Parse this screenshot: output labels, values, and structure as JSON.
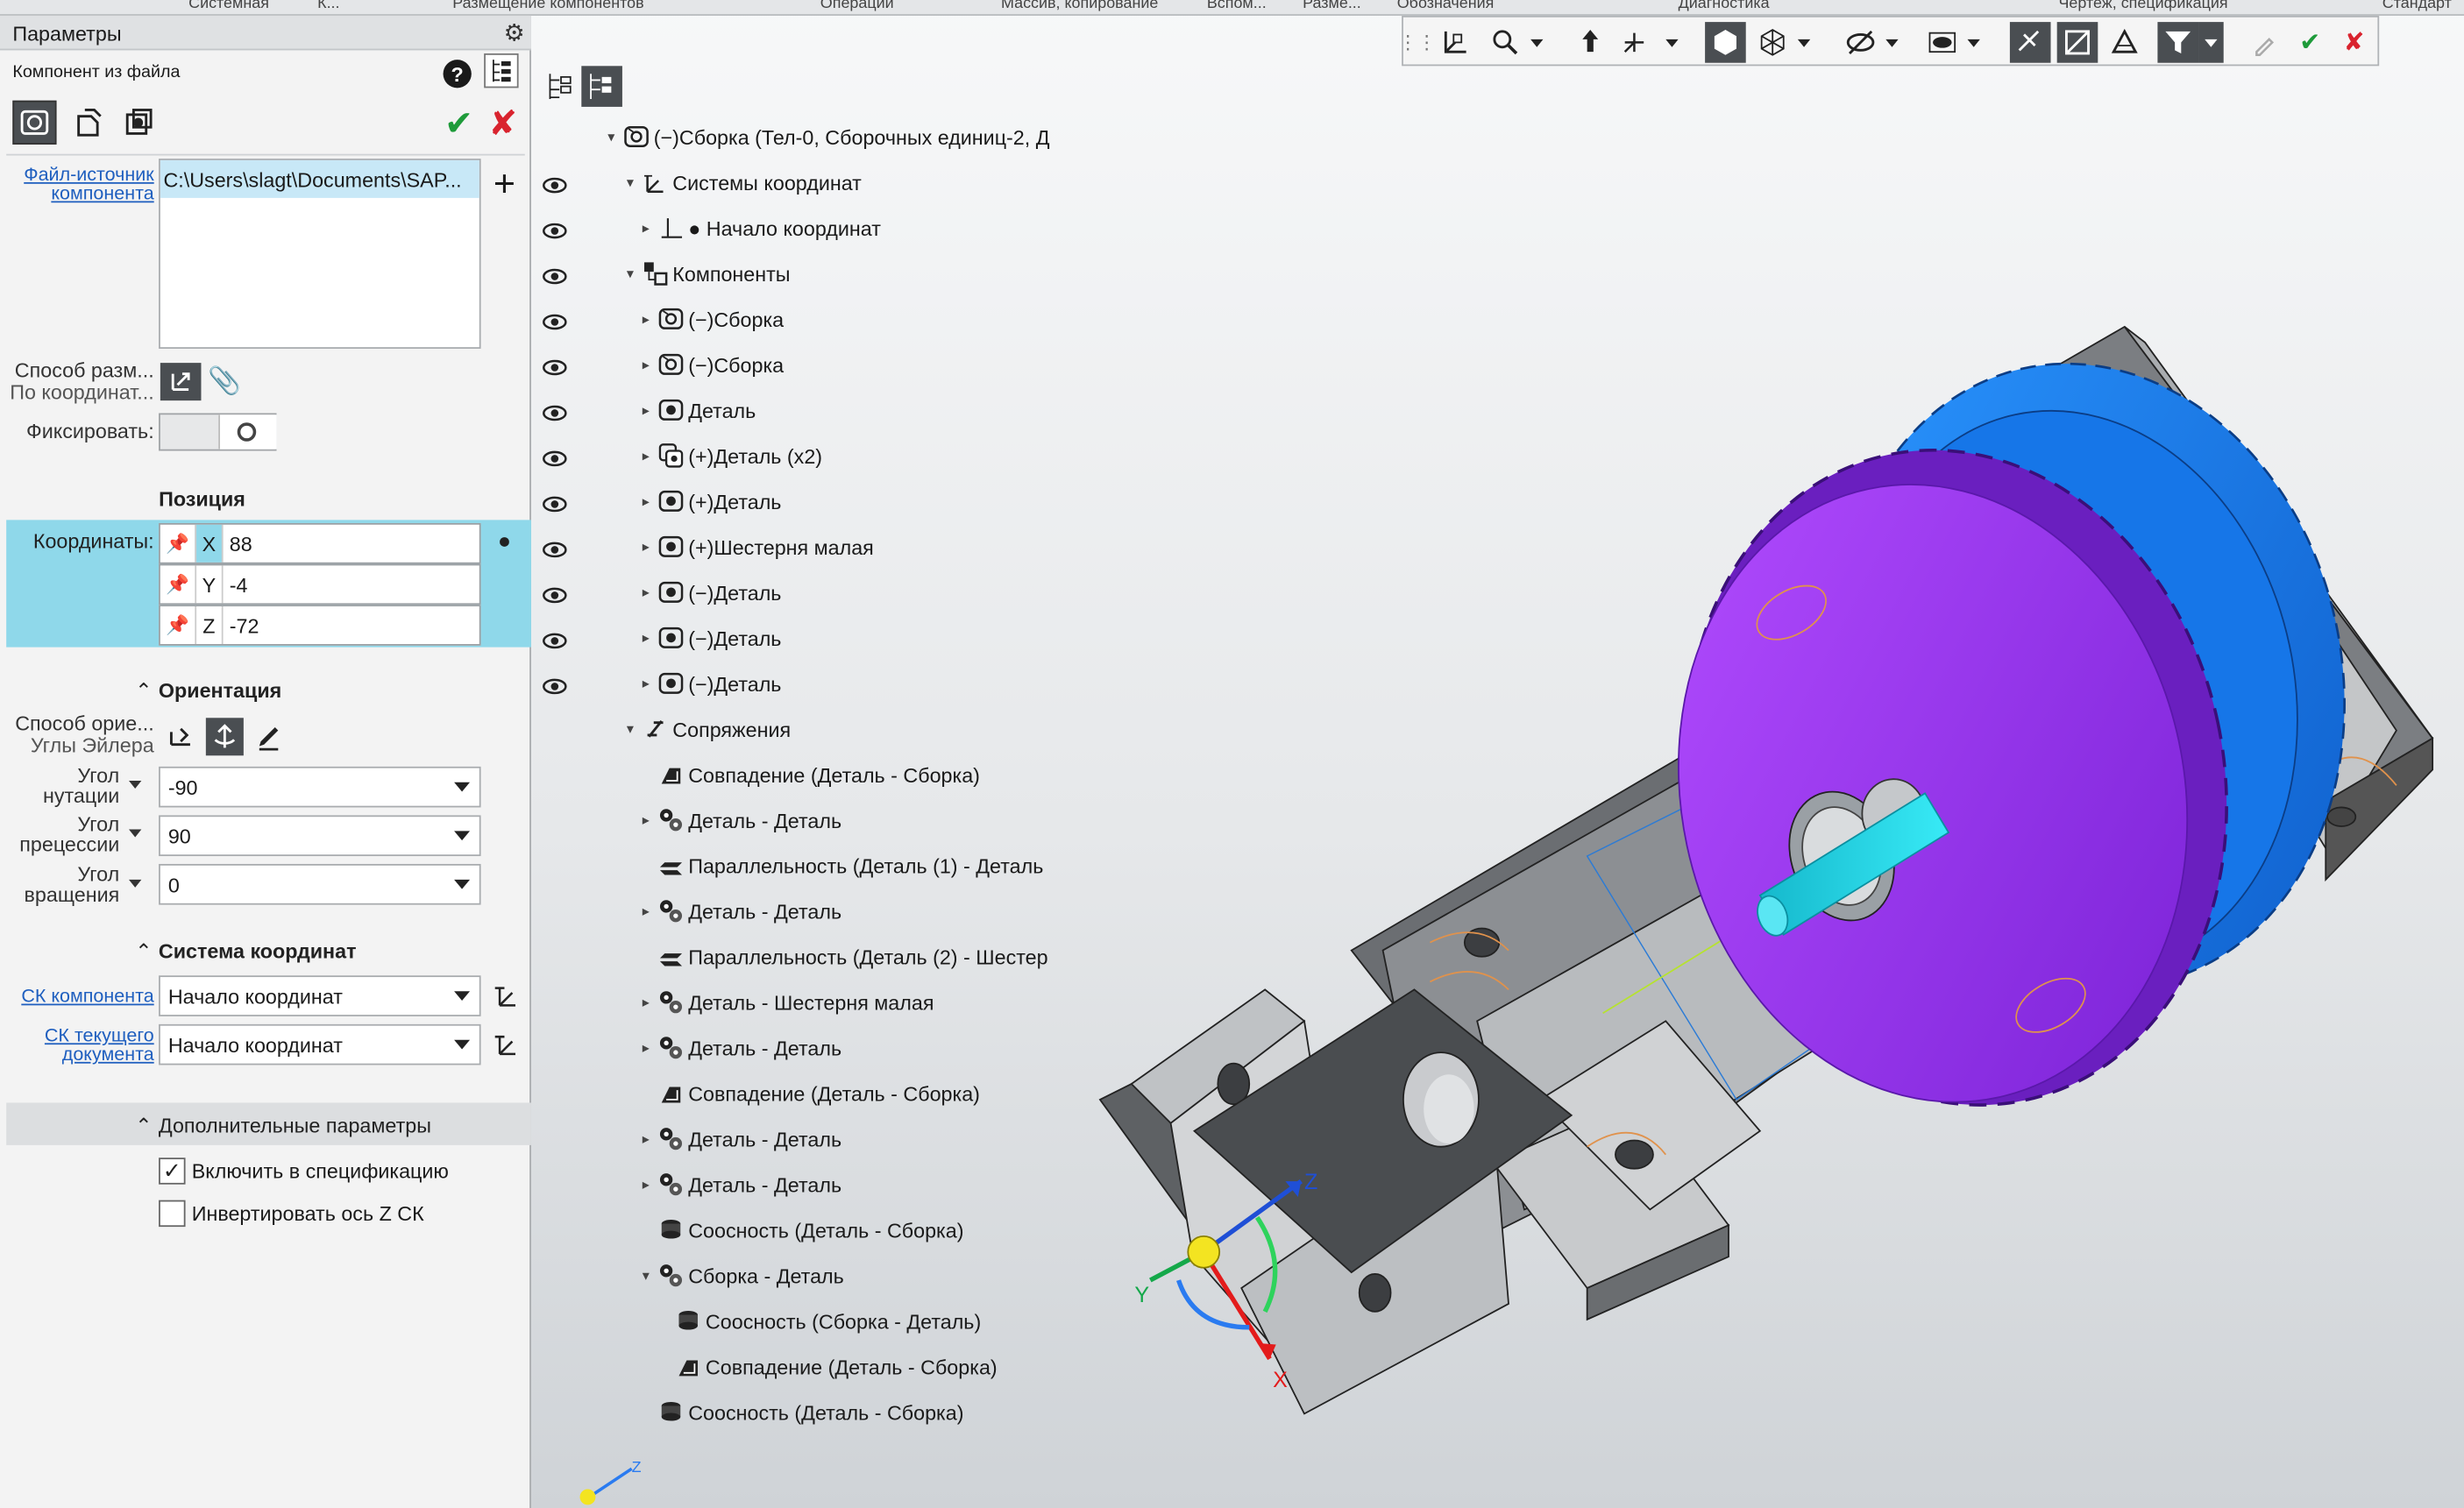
{
  "ribbon_tabs": [
    "Системная",
    "К...",
    "Размещение компонентов",
    "Операции",
    "Массив, копирование",
    "Вспом...",
    "Разме...",
    "Обозначения",
    "Диагностика",
    "Чертеж, спецификация",
    "Стандарт"
  ],
  "panel": {
    "title": "Параметры",
    "subtitle": "Компонент из файла",
    "source_label": "Файл-источник компонента",
    "source_value": "C:\\Users\\slagt\\Documents\\SAP...",
    "placement_label": "Способ разм...",
    "placement_value": "По координат...",
    "fix_label": "Фиксировать:",
    "position_header": "Позиция",
    "coords_label": "Координаты:",
    "coords": [
      {
        "axis": "X",
        "value": "88"
      },
      {
        "axis": "Y",
        "value": "-4"
      },
      {
        "axis": "Z",
        "value": "-72"
      }
    ],
    "orientation_header": "Ориентация",
    "orient_method_label": "Способ орие...",
    "orient_method_value": "Углы Эйлера",
    "angles": [
      {
        "label1": "Угол",
        "label2": "нутации",
        "value": "-90"
      },
      {
        "label1": "Угол",
        "label2": "прецессии",
        "value": "90"
      },
      {
        "label1": "Угол",
        "label2": "вращения",
        "value": "0"
      }
    ],
    "cs_header": "Система координат",
    "cs_component_label": "СК компонента",
    "cs_component_value": "Начало координат",
    "cs_document_label1": "СК текущего",
    "cs_document_label2": "документа",
    "cs_document_value": "Начало координат",
    "extra_header": "Дополнительные параметры",
    "include_spec_label": "Включить в спецификацию",
    "include_spec_checked": true,
    "invert_z_label": "Инвертировать ось Z СК",
    "invert_z_checked": false
  },
  "tree": [
    {
      "text": "(−)Сборка (Тел-0, Сборочных единиц-2, Д",
      "level": 0,
      "icon": "assembly",
      "expand": "open",
      "eye": false
    },
    {
      "text": "Системы координат",
      "level": 1,
      "icon": "cs",
      "expand": "open",
      "eye": true
    },
    {
      "text": "● Начало координат",
      "level": 2,
      "icon": "origin",
      "expand": "closed",
      "eye": true
    },
    {
      "text": "Компоненты",
      "level": 1,
      "icon": "components",
      "expand": "open",
      "eye": true
    },
    {
      "text": "(−)Сборка",
      "level": 2,
      "icon": "assembly",
      "expand": "closed",
      "eye": true
    },
    {
      "text": "(−)Сборка",
      "level": 2,
      "icon": "assembly",
      "expand": "closed",
      "eye": true
    },
    {
      "text": "Деталь",
      "level": 2,
      "icon": "pinpart",
      "expand": "closed",
      "eye": true
    },
    {
      "text": "(+)Деталь (x2)",
      "level": 2,
      "icon": "part2",
      "expand": "closed",
      "eye": true
    },
    {
      "text": "(+)Деталь",
      "level": 2,
      "icon": "part",
      "expand": "closed",
      "eye": true
    },
    {
      "text": "(+)Шестерня малая",
      "level": 2,
      "icon": "part",
      "expand": "closed",
      "eye": true
    },
    {
      "text": "(−)Деталь",
      "level": 2,
      "icon": "part",
      "expand": "closed",
      "eye": true
    },
    {
      "text": "(−)Деталь",
      "level": 2,
      "icon": "part",
      "expand": "closed",
      "eye": true
    },
    {
      "text": "(−)Деталь",
      "level": 2,
      "icon": "part",
      "expand": "closed",
      "eye": true
    },
    {
      "text": "Сопряжения",
      "level": 1,
      "icon": "mates",
      "expand": "open",
      "eye": false
    },
    {
      "text": "Совпадение (Деталь  -  Сборка)",
      "level": 2,
      "icon": "coincide",
      "expand": "none",
      "eye": false
    },
    {
      "text": "Деталь - Деталь",
      "level": 2,
      "icon": "gearmate",
      "expand": "closed",
      "eye": false
    },
    {
      "text": "Параллельность (Деталь (1)  -  Деталь",
      "level": 2,
      "icon": "parallel",
      "expand": "none",
      "eye": false
    },
    {
      "text": "Деталь - Деталь",
      "level": 2,
      "icon": "gearmate",
      "expand": "closed",
      "eye": false
    },
    {
      "text": "Параллельность (Деталь (2)  -  Шестер",
      "level": 2,
      "icon": "parallel",
      "expand": "none",
      "eye": false
    },
    {
      "text": "Деталь - Шестерня малая",
      "level": 2,
      "icon": "gearmate",
      "expand": "closed",
      "eye": false
    },
    {
      "text": "Деталь - Деталь",
      "level": 2,
      "icon": "gearmate",
      "expand": "closed",
      "eye": false
    },
    {
      "text": "Совпадение (Деталь  -  Сборка)",
      "level": 2,
      "icon": "coincide",
      "expand": "none",
      "eye": false
    },
    {
      "text": "Деталь - Деталь",
      "level": 2,
      "icon": "gearmate",
      "expand": "closed",
      "eye": false
    },
    {
      "text": "Деталь - Деталь",
      "level": 2,
      "icon": "gearmate",
      "expand": "closed",
      "eye": false
    },
    {
      "text": "Соосность (Деталь  -  Сборка)",
      "level": 2,
      "icon": "coaxial",
      "expand": "none",
      "eye": false
    },
    {
      "text": "Сборка - Деталь",
      "level": 2,
      "icon": "gearmate",
      "expand": "open",
      "eye": false
    },
    {
      "text": "Соосность (Сборка  -  Деталь)",
      "level": 3,
      "icon": "coaxial",
      "expand": "none",
      "eye": false
    },
    {
      "text": "Совпадение (Деталь  -  Сборка)",
      "level": 3,
      "icon": "coincide",
      "expand": "none",
      "eye": false
    },
    {
      "text": "Соосность (Деталь  -  Сборка)",
      "level": 2,
      "icon": "coaxial",
      "expand": "none",
      "eye": false
    }
  ],
  "triad": {
    "x": "X",
    "y": "Y",
    "z": "Z"
  },
  "colors": {
    "selection": "#8fd8ea",
    "gear_front": "#8a2be2",
    "gear_back": "#1e88ff",
    "shaft": "#22d3e6",
    "ok": "#1e9b3a",
    "cancel": "#d9232e"
  }
}
